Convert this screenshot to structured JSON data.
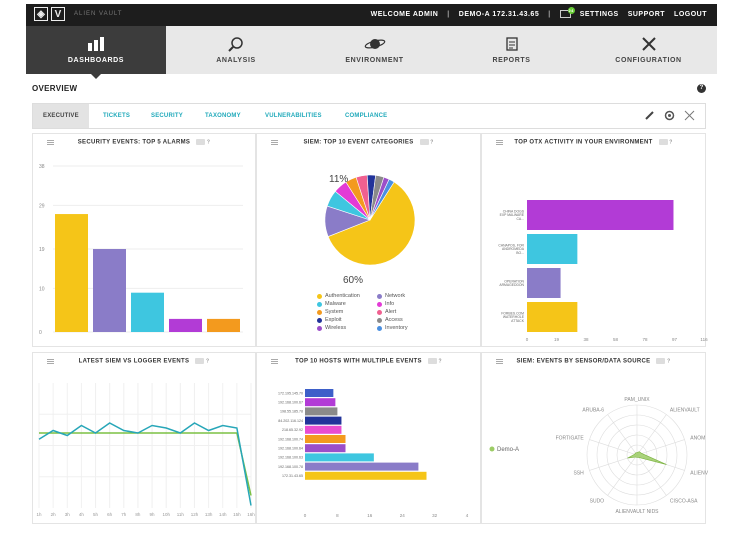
{
  "topbar": {
    "logo_letter": "V",
    "brand": "ALIEN VAULT",
    "welcome": "WELCOME ADMIN",
    "host": "DEMO-A 172.31.43.65",
    "mail_count": "24",
    "links": [
      "SETTINGS",
      "SUPPORT",
      "LOGOUT"
    ]
  },
  "mainnav": {
    "items": [
      {
        "label": "DASHBOARDS",
        "icon": "bar-chart-icon"
      },
      {
        "label": "ANALYSIS",
        "icon": "magnifier-icon"
      },
      {
        "label": "ENVIRONMENT",
        "icon": "planet-icon"
      },
      {
        "label": "REPORTS",
        "icon": "document-icon"
      },
      {
        "label": "CONFIGURATION",
        "icon": "tools-icon"
      }
    ]
  },
  "page": {
    "title": "OVERVIEW",
    "help": "?"
  },
  "subtabs": [
    "EXECUTIVE",
    "TICKETS",
    "SECURITY",
    "TAXONOMY",
    "VULNERABILITIES",
    "COMPLIANCE"
  ],
  "panels": {
    "alarms": {
      "title": "SECURITY EVENTS: TOP 5 ALARMS"
    },
    "siem": {
      "title": "SIEM: TOP 10 EVENT CATEGORIES"
    },
    "otx": {
      "title": "TOP OTX ACTIVITY IN YOUR ENVIRONMENT"
    },
    "logger": {
      "title": "LATEST SIEM VS LOGGER EVENTS"
    },
    "hosts": {
      "title": "TOP 10 HOSTS WITH MULTIPLE EVENTS"
    },
    "sensor": {
      "title": "SIEM: EVENTS BY SENSOR/DATA SOURCE"
    }
  },
  "chart_data": [
    {
      "type": "bar",
      "id": "alarms",
      "values": [
        27,
        19,
        9,
        3,
        3
      ],
      "colors": [
        "#f5c518",
        "#8a7cc8",
        "#3ec6e0",
        "#b23bd6",
        "#f39a1e"
      ],
      "yticks": [
        "0",
        "10",
        "19",
        "29",
        "38"
      ],
      "ylim": [
        0,
        38
      ]
    },
    {
      "type": "pie",
      "id": "siem",
      "labels": [
        "Authentication",
        "Network",
        "Malware",
        "Info",
        "System",
        "Alert",
        "Exploit",
        "Access",
        "Wireless",
        "Inventory"
      ],
      "values": [
        60,
        11,
        6,
        5,
        4,
        4,
        3,
        3,
        2,
        2
      ],
      "colors": [
        "#f5c518",
        "#8a7cc8",
        "#3ec6e0",
        "#e33bd6",
        "#f39a1e",
        "#f06090",
        "#22339a",
        "#8a8a8a",
        "#9b4ec9",
        "#4a8fe0"
      ],
      "annotations": [
        "11%",
        "60%"
      ]
    },
    {
      "type": "bar",
      "id": "otx",
      "orientation": "horizontal",
      "categories": [
        "CHINA DOGS EXP MALWARE CA...",
        "CANAPOS, FOR ANDROMEDA BO...",
        "OPERATION ARMAGEDDON",
        "FORBES.COM WATERHOLE ATTACK"
      ],
      "values": [
        96,
        33,
        22,
        33
      ],
      "colors": [
        "#b23bd6",
        "#3ec6e0",
        "#8a7cc8",
        "#f5c518"
      ],
      "xticks": [
        "0",
        "19",
        "38",
        "58",
        "78",
        "97",
        "116"
      ],
      "xlim": [
        0,
        116
      ]
    },
    {
      "type": "line",
      "id": "logger",
      "x": [
        "1h",
        "2h",
        "3h",
        "4h",
        "5h",
        "6h",
        "7h",
        "8h",
        "9h",
        "10h",
        "11h",
        "12h",
        "13h",
        "14h",
        "15h",
        "16h"
      ],
      "series": [
        {
          "values": [
            0.55,
            0.62,
            0.58,
            0.66,
            0.6,
            0.68,
            0.62,
            0.6,
            0.66,
            0.64,
            0.6,
            0.68,
            0.62,
            0.66,
            0.64,
            0.02
          ],
          "color": "#27a6b8"
        },
        {
          "values": [
            0.6,
            0.6,
            0.6,
            0.6,
            0.6,
            0.6,
            0.6,
            0.6,
            0.6,
            0.6,
            0.6,
            0.6,
            0.6,
            0.6,
            0.6,
            0.1
          ],
          "color": "#7bc043"
        }
      ]
    },
    {
      "type": "bar",
      "id": "hosts",
      "orientation": "horizontal",
      "categories": [
        "172.195.145.70",
        "192.168.100.67",
        "198.55.185.78",
        "84.202.116.124",
        "218.65.32.92",
        "192.168.100.74",
        "192.168.100.64",
        "192.168.100.63",
        "192.168.100.78",
        "172.31.43.65"
      ],
      "values": [
        7,
        7.5,
        8,
        9,
        9,
        10,
        10,
        17,
        28,
        30
      ],
      "colors": [
        "#3d5fc9",
        "#b23bd6",
        "#8a8a8a",
        "#22339a",
        "#e84cd0",
        "#f39a1e",
        "#9b4ec9",
        "#3ec6e0",
        "#8a7cc8",
        "#f5c518"
      ],
      "xticks": [
        "0",
        "8",
        "16",
        "24",
        "32",
        "4"
      ],
      "xlim": [
        0,
        40
      ]
    },
    {
      "type": "radar",
      "id": "sensor",
      "axes": [
        "PAM_UNIX",
        "ALIENVAULT",
        "ANOM",
        "ALIENV",
        "CISCO-ASA",
        "ALIENVAULT NIDS",
        "SUDO",
        "SSH",
        "FORTIGATE",
        "ARUBA-6"
      ],
      "series": [
        {
          "name": "Demo-A",
          "values": [
            0.05,
            0.08,
            0.1,
            0.62,
            0.06,
            0.05,
            0.05,
            0.2,
            0.05,
            0.05
          ],
          "color": "#9ccc65"
        }
      ]
    }
  ]
}
